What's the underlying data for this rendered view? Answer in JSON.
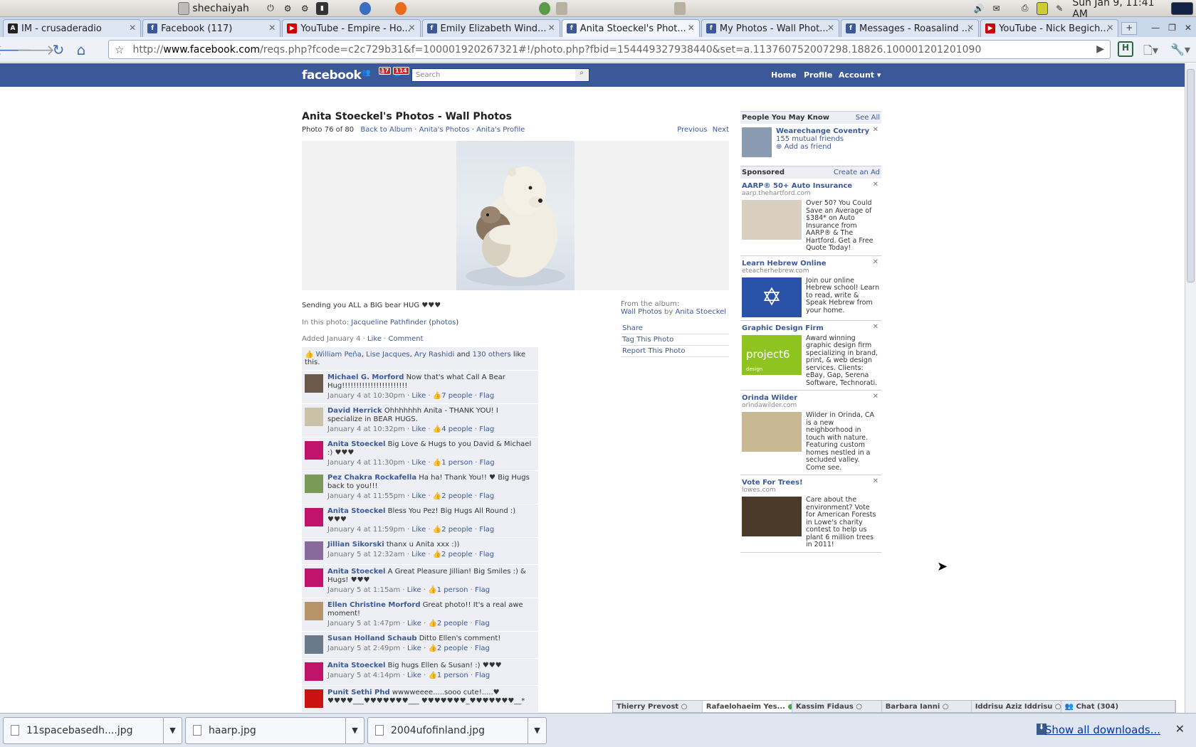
{
  "system": {
    "user": "shechaiyah",
    "clock": "Sun Jan  9, 11:41 AM"
  },
  "tabs": [
    {
      "label": "IM - crusaderadio",
      "icon": "aol-icon",
      "color": "#222"
    },
    {
      "label": "Facebook (117)",
      "icon": "facebook-icon",
      "color": "#3b5998"
    },
    {
      "label": "YouTube - Empire - Ho...",
      "icon": "youtube-icon",
      "color": "#cc0000"
    },
    {
      "label": "Emily Elizabeth Wind...",
      "icon": "facebook-icon",
      "color": "#3b5998"
    },
    {
      "label": "Anita Stoeckel's Phot...",
      "icon": "facebook-icon",
      "color": "#3b5998"
    },
    {
      "label": "My Photos - Wall Phot...",
      "icon": "facebook-icon",
      "color": "#3b5998"
    },
    {
      "label": "Messages - Roasalind ...",
      "icon": "facebook-icon",
      "color": "#3b5998"
    },
    {
      "label": "YouTube - Nick Begich...",
      "icon": "youtube-icon",
      "color": "#cc0000"
    }
  ],
  "address": {
    "prefix": "http://",
    "host": "www.facebook.com",
    "path": "/reqs.php?fcode=c2c729b31&f=100001920267321#!/photo.php?fbid=154449327938440&set=a.113760752007298.18826.100001201201090"
  },
  "fb": {
    "logo": "facebook",
    "badge_requests": "17",
    "badge_notifications": "114",
    "search_placeholder": "Search",
    "nav_home": "Home",
    "nav_profile": "Profile",
    "nav_account": "Account ▾"
  },
  "photo": {
    "title": "Anita Stoeckel's Photos - Wall Photos",
    "counter": "Photo 76 of 80",
    "back_album": "Back to Album",
    "anitas_photos": "Anita's Photos",
    "anitas_profile": "Anita's Profile",
    "previous": "Previous",
    "next": "Next",
    "caption": "Sending you ALL a BIG bear HUG ♥♥♥",
    "in_photo_label": "In this photo:",
    "tagged_name": "Jacqueline Pathfinder",
    "tagged_photos": "photos",
    "added": "Added January 4",
    "like": "Like",
    "comment": "Comment"
  },
  "album": {
    "from_label": "From the album:",
    "album_name": "Wall Photos",
    "by": "by",
    "owner": "Anita Stoeckel",
    "share": "Share",
    "tag": "Tag This Photo",
    "report": "Report This Photo"
  },
  "likes": {
    "names": [
      "William Peña",
      "Lise Jacques",
      "Ary Rashidi"
    ],
    "and": "and",
    "others": "130 others",
    "suffix": "like this."
  },
  "comments": [
    {
      "name": "Michael G. Morford",
      "text": "Now that's what Call A Bear Hug!!!!!!!!!!!!!!!!!!!!!!!",
      "time": "January 4 at 10:30pm",
      "likes": "7 people",
      "av": "#6b5a4a"
    },
    {
      "name": "David Herrick",
      "text": "Ohhhhhhh Anita - THANK YOU! I specialize in BEAR HUGS.",
      "time": "January 4 at 10:32pm",
      "likes": "4 people",
      "av": "#c9c2a8"
    },
    {
      "name": "Anita Stoeckel",
      "text": "Big Love & Hugs to you David & Michael :) ♥♥♥",
      "time": "January 4 at 11:30pm",
      "likes": "1 person",
      "av": "#c0146a"
    },
    {
      "name": "Pez Chakra Rockafella",
      "text": "Ha ha! Thank You!! ♥ Big Hugs back to you!!!",
      "time": "January 4 at 11:55pm",
      "likes": "2 people",
      "av": "#7a9a5a"
    },
    {
      "name": "Anita Stoeckel",
      "text": "Bless You Pez! Big Hugs All Round :) ♥♥♥",
      "time": "January 4 at 11:59pm",
      "likes": "2 people",
      "av": "#c0146a"
    },
    {
      "name": "Jillian Sikorski",
      "text": "thanx u Anita xxx :))",
      "time": "January 5 at 12:32am",
      "likes": "2 people",
      "av": "#8a6a9a"
    },
    {
      "name": "Anita Stoeckel",
      "text": "A Great Pleasure Jillian! Big Smiles :) & Hugs! ♥♥♥",
      "time": "January 5 at 1:15am",
      "likes": "1 person",
      "av": "#c0146a"
    },
    {
      "name": "Ellen Christine Morford",
      "text": "Great photo!! It's a real awe moment!",
      "time": "January 5 at 1:47pm",
      "likes": "2 people",
      "av": "#b8946a"
    },
    {
      "name": "Susan Holland Schaub",
      "text": "Ditto Ellen's comment!",
      "time": "January 5 at 2:49pm",
      "likes": "2 people",
      "av": "#6a7a8a"
    },
    {
      "name": "Anita Stoeckel",
      "text": "Big hugs Ellen & Susan! :) ♥♥♥",
      "time": "January 5 at 4:14pm",
      "likes": "1 person",
      "av": "#c0146a"
    },
    {
      "name": "Punit Sethi Phd",
      "text": "wwwweeee.....sooo cute!.....♥ ♥♥♥♥___♥♥♥♥♥♥♥___ ♥♥♥♥♥♥♥_♥♥♥♥♥♥♥__*",
      "time": "",
      "likes": "",
      "av": "#cc1111"
    }
  ],
  "comment_actions": {
    "like": "Like",
    "flag": "Flag"
  },
  "sidebar": {
    "pymk_title": "People You May Know",
    "see_all": "See All",
    "pymk_name": "Wearechange Coventry",
    "pymk_mutual": "155 mutual friends",
    "pymk_add": "Add as friend",
    "sponsored": "Sponsored",
    "create_ad": "Create an Ad",
    "ads": [
      {
        "title": "AARP® 50+ Auto Insurance",
        "domain": "aarp.thehartford.com",
        "text": "Over 50? You Could Save an Average of $384* on Auto Insurance from AARP® & The Hartford. Get a Free Quote Today!",
        "img": "#d9cfc0"
      },
      {
        "title": "Learn Hebrew Online",
        "domain": "eteacherhebrew.com",
        "text": "Join our online Hebrew school! Learn to read, write & Speak Hebrew from your home.",
        "img": "#2a52a8"
      },
      {
        "title": "Graphic Design Firm",
        "domain": "",
        "text": "Award winning graphic design firm specializing in brand, print, & web design services. Clients: eBay, Gap, Serena Software, Technorati.",
        "img": "#8fc31f",
        "logo": "project6",
        "logo_sub": "design"
      },
      {
        "title": "Orinda Wilder",
        "domain": "orindawilder.com",
        "text": "Wilder in Orinda, CA is a new neighborhood in touch with nature. Featuring custom homes nestled in a secluded valley. Come see.",
        "img": "#c8b894"
      },
      {
        "title": "Vote For Trees!",
        "domain": "lowes.com",
        "text": "Care about the environment? Vote for American Forests in Lowe's charity contest to help us plant 6 million trees in 2011!",
        "img": "#4a3a2a"
      }
    ]
  },
  "chat": {
    "items": [
      "Thierry Prevost",
      "Rafaelohaeim Yes...",
      "Kassim Fidaus",
      "Barbara Ianni",
      "Iddrisu Aziz Iddrisu"
    ],
    "chat_label": "Chat (304)"
  },
  "downloads": {
    "files": [
      "11spacebasedh....jpg",
      "haarp.jpg",
      "2004ufofinland.jpg"
    ],
    "show_all": "Show all downloads..."
  }
}
